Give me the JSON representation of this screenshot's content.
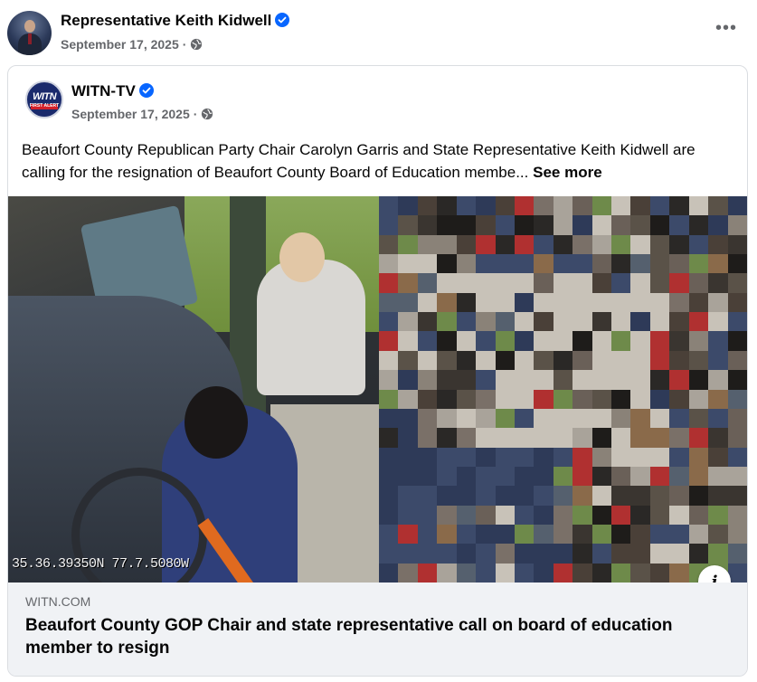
{
  "post": {
    "author": "Representative Keith Kidwell",
    "date": "September 17, 2025",
    "separator": "·",
    "privacy_icon": "globe-icon",
    "more_icon": "more-options-icon",
    "more_label": "•••"
  },
  "shared": {
    "author": "WITN-TV",
    "logo_text": "WITN",
    "logo_sub": "FIRST ALERT",
    "date": "September 17, 2025",
    "separator": "·",
    "text": "Beaufort County Republican Party Chair Carolyn Garris and State Representative Keith Kidwell are calling for the resignation of Beaufort County Board of Education membe...",
    "see_more": "See more"
  },
  "media": {
    "camera_stamp": "35.36.39350N 77.7.5080W",
    "info_label": "i"
  },
  "link": {
    "domain": "WITN.COM",
    "title": "Beaufort County GOP Chair and state representative call on board of education member to resign"
  },
  "colors": {
    "verified": "#0866ff",
    "secondary_text": "#65676b",
    "footer_bg": "#f0f2f5"
  }
}
